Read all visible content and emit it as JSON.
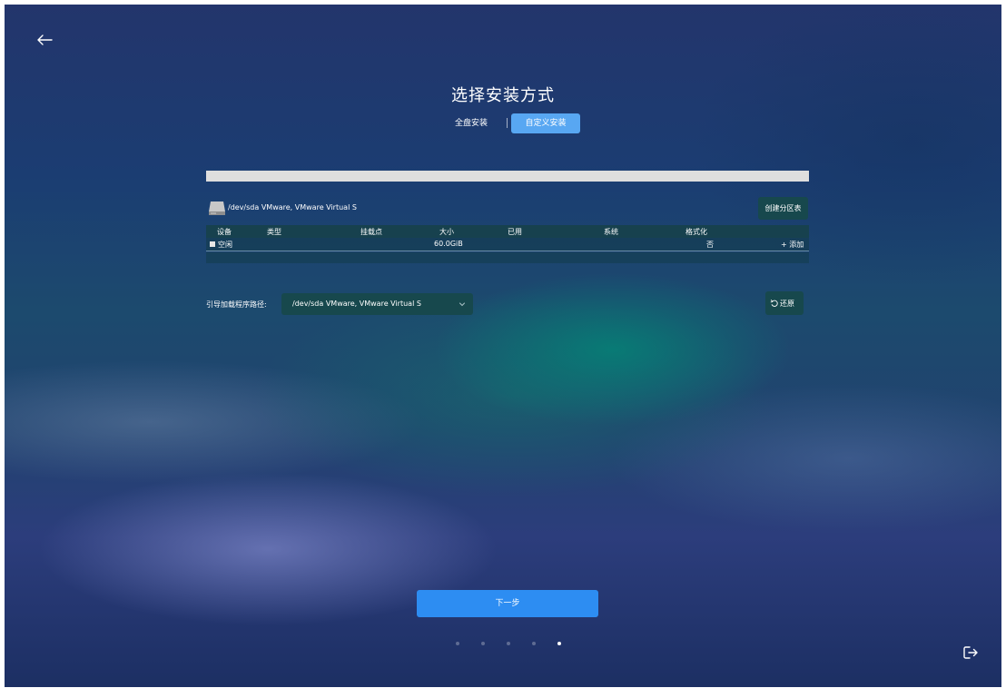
{
  "header": {
    "title": "选择安装方式"
  },
  "install_modes": {
    "full": "全盘安装",
    "custom": "自定义安装",
    "active": "custom"
  },
  "progress": {
    "fill": 1.0
  },
  "disk": {
    "label": "/dev/sda VMware, VMware Virtual S",
    "icon": "hard-disk-icon",
    "create_table_label": "创建分区表"
  },
  "table": {
    "headers": {
      "device": "设备",
      "type": "类型",
      "mount": "挂载点",
      "size": "大小",
      "used": "已用",
      "system": "系统",
      "format": "格式化"
    },
    "rows": [
      {
        "device": "空闲",
        "type": "",
        "mount": "",
        "size": "60.0GiB",
        "used": "",
        "system": "",
        "format": "否",
        "action": "+ 添加"
      }
    ]
  },
  "bootloader": {
    "label": "引导加载程序路径:",
    "value": "/dev/sda VMware, VMware Virtual S"
  },
  "actions": {
    "restore_label": "还原",
    "next_label": "下一步"
  },
  "pagination": {
    "total": 5,
    "current": 5
  },
  "icons": {
    "back": "back-arrow-icon",
    "exit": "exit-icon",
    "restore": "undo-icon",
    "chevron": "chevron-down-icon"
  },
  "colors": {
    "primary": "#2d8df2",
    "tab_active": "#58a7f2",
    "panel": "#17484d",
    "table_header": "#17414e"
  }
}
